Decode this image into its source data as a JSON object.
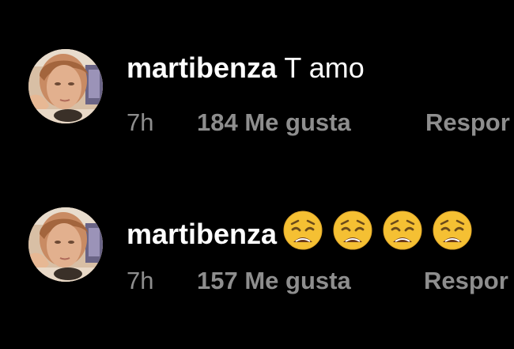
{
  "comments": [
    {
      "username": "martibenza",
      "text": "T amo",
      "time": "7h",
      "likes": "184 Me gusta",
      "reply_label": "Respor"
    },
    {
      "username": "martibenza",
      "text": "",
      "emojis": [
        "weary-face",
        "weary-face",
        "weary-face",
        "weary-face"
      ],
      "time": "7h",
      "likes": "157 Me gusta",
      "reply_label": "Respor"
    }
  ],
  "colors": {
    "background": "#000000",
    "primary_text": "#ffffff",
    "secondary_text": "#8e8e8e",
    "emoji_face": "#f5c033"
  }
}
